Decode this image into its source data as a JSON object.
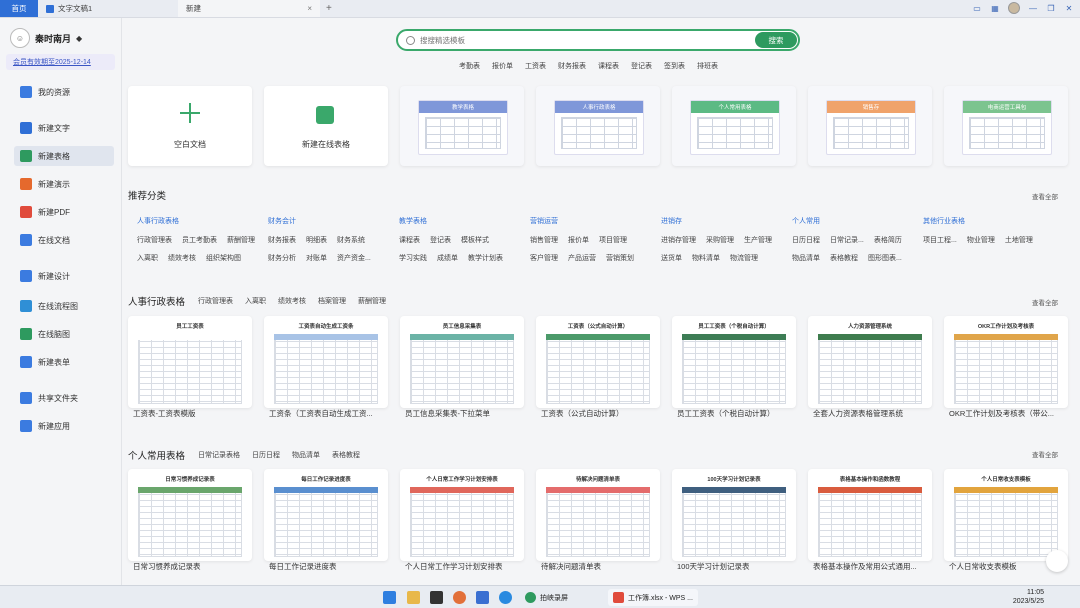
{
  "tabs": {
    "home": "首页",
    "doc": "文字文稿1",
    "new": "新建"
  },
  "profile": {
    "name": "秦时南月",
    "vip": "会员有效期至2025-12-14"
  },
  "sidebar": {
    "items": [
      {
        "label": "我的资源",
        "color": "#3b7be0"
      },
      {
        "label": "新建文字",
        "color": "#2f6fd6"
      },
      {
        "label": "新建表格",
        "color": "#2e9a5f"
      },
      {
        "label": "新建演示",
        "color": "#e5692d"
      },
      {
        "label": "新建PDF",
        "color": "#e04b3c"
      },
      {
        "label": "在线文档",
        "color": "#3b7be0"
      },
      {
        "label": "新建设计",
        "color": "#3b7be0"
      },
      {
        "label": "在线流程图",
        "color": "#2f8fd6"
      },
      {
        "label": "在线脑图",
        "color": "#2e9a5f"
      },
      {
        "label": "新建表单",
        "color": "#3b7be0"
      },
      {
        "label": "共享文件夹",
        "color": "#3b7be0"
      },
      {
        "label": "新建应用",
        "color": "#3b7be0"
      }
    ]
  },
  "search": {
    "placeholder": "搜搜精选模板",
    "button": "搜索",
    "quick_tags": [
      "考勤表",
      "报价单",
      "工资表",
      "财务报表",
      "课程表",
      "登记表",
      "签到表",
      "排班表"
    ]
  },
  "top_cards": [
    {
      "label": "空白文档"
    },
    {
      "label": "新建在线表格"
    },
    {
      "label": "",
      "thumb_title": "教学表格",
      "color": "#7f97d9"
    },
    {
      "label": "",
      "thumb_title": "人事行政表格",
      "color": "#7f97d9"
    },
    {
      "label": "",
      "thumb_title": "个人常用表格",
      "color": "#5cba84"
    },
    {
      "label": "",
      "thumb_title": "销售存",
      "color": "#f0a36b"
    },
    {
      "label": "",
      "thumb_title": "电商运营工具包",
      "color": "#7cc48f"
    }
  ],
  "recommend": {
    "title": "推荐分类",
    "see_all": "查看全部",
    "categories": [
      {
        "head": "人事行政表格",
        "rows": [
          [
            "行政管理表",
            "员工考勤表",
            "薪酬管理"
          ],
          [
            "入离职",
            "绩效考核",
            "组织架构图"
          ]
        ]
      },
      {
        "head": "财务会计",
        "rows": [
          [
            "财务报表",
            "明细表",
            "财务系统"
          ],
          [
            "财务分析",
            "对账单",
            "资产资金..."
          ]
        ]
      },
      {
        "head": "教学表格",
        "rows": [
          [
            "课程表",
            "登记表",
            "模板样式"
          ],
          [
            "学习实践",
            "成绩单",
            "教学计划表"
          ]
        ]
      },
      {
        "head": "营销运营",
        "rows": [
          [
            "销售管理",
            "报价单",
            "项目管理"
          ],
          [
            "客户管理",
            "产品运营",
            "营销策划"
          ]
        ]
      },
      {
        "head": "进销存",
        "rows": [
          [
            "进销存管理",
            "采购管理",
            "生产管理"
          ],
          [
            "送货单",
            "物料清单",
            "物流管理"
          ]
        ]
      },
      {
        "head": "个人常用",
        "rows": [
          [
            "日历日程",
            "日常记录...",
            "表格简历"
          ],
          [
            "物品清单",
            "表格教程",
            "图形图表..."
          ]
        ]
      },
      {
        "head": "其他行业表格",
        "rows": [
          [
            "项目工程...",
            "物业管理",
            "土地管理"
          ]
        ]
      }
    ]
  },
  "hr_section": {
    "title": "人事行政表格",
    "see_all": "查看全部",
    "tabs": [
      "行政管理表",
      "入离职",
      "绩效考核",
      "档案管理",
      "薪酬管理"
    ],
    "cards": [
      {
        "label": "工资表-工资表模版",
        "thumb": "员工工资表",
        "band": "#ffffff"
      },
      {
        "label": "工资条（工资表自动生成工资...",
        "thumb": "工资表自动生成工资条",
        "band": "#a8c3e6"
      },
      {
        "label": "员工信息采集表-下拉菜单",
        "thumb": "员工信息采集表",
        "band": "#6bb3a6"
      },
      {
        "label": "工资表（公式自动计算）",
        "thumb": "工资表（公式自动计算）",
        "band": "#4c9a6a"
      },
      {
        "label": "员工工资表（个税自动计算）",
        "thumb": "员工工资表（个税自动计算）",
        "band": "#3d7d55"
      },
      {
        "label": "全套人力资源表格管理系统",
        "thumb": "人力资源管理系统",
        "band": "#3e7c4e"
      },
      {
        "label": "OKR工作计划及考核表（带公...",
        "thumb": "OKR工作计划及考核表",
        "band": "#e0a54a"
      }
    ]
  },
  "personal_section": {
    "title": "个人常用表格",
    "see_all": "查看全部",
    "tabs": [
      "日常记录表格",
      "日历日程",
      "物品清单",
      "表格教程"
    ],
    "cards": [
      {
        "label": "日常习惯养成记录表",
        "thumb": "日常习惯养成记录表",
        "band": "#6aa66c"
      },
      {
        "label": "每日工作记录进度表",
        "thumb": "每日工作记录进度表",
        "band": "#5a8fcf"
      },
      {
        "label": "个人日常工作学习计划安排表",
        "thumb": "个人日常工作学习计划安排表",
        "band": "#e0675b"
      },
      {
        "label": "待解决问题清单表",
        "thumb": "待解决问题清单表",
        "band": "#e46c6c"
      },
      {
        "label": "100天学习计划记录表",
        "thumb": "100天学习计划记录表",
        "band": "#3f5f7f"
      },
      {
        "label": "表格基本操作及常用公式通用...",
        "thumb": "表格基本操作和函数教程",
        "band": "#d95c3e"
      },
      {
        "label": "个人日常收支表模板",
        "thumb": "个人日常收支表模板",
        "band": "#e2a43d"
      }
    ]
  },
  "taskbar": {
    "app1": "拍峡录屏",
    "app2": "工作簿.xlsx - WPS ...",
    "time": "11:05",
    "date": "2023/5/25"
  }
}
